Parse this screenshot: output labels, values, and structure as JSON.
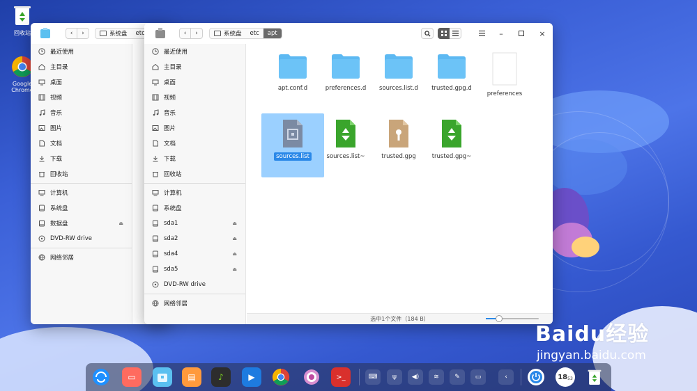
{
  "desktop": {
    "icons": [
      {
        "label": "回收站"
      },
      {
        "label": "Google Chrome",
        "label_line1": "Google",
        "label_line2": "Chrome"
      }
    ]
  },
  "back_window": {
    "breadcrumb": [
      "系统盘",
      "etc"
    ],
    "sidebar": [
      {
        "label": "最近使用",
        "icon": "clock-icon"
      },
      {
        "label": "主目录",
        "icon": "home-icon"
      },
      {
        "label": "桌面",
        "icon": "desktop-icon"
      },
      {
        "label": "视频",
        "icon": "video-icon"
      },
      {
        "label": "音乐",
        "icon": "music-icon"
      },
      {
        "label": "图片",
        "icon": "image-icon"
      },
      {
        "label": "文档",
        "icon": "document-icon"
      },
      {
        "label": "下载",
        "icon": "download-icon"
      },
      {
        "label": "回收站",
        "icon": "trash-icon"
      },
      {
        "label": "计算机",
        "icon": "computer-icon"
      },
      {
        "label": "系统盘",
        "icon": "drive-icon"
      },
      {
        "label": "数据盘",
        "icon": "drive-icon",
        "ejectable": true
      },
      {
        "label": "DVD-RW drive",
        "icon": "disc-icon"
      },
      {
        "label": "网络邻居",
        "icon": "network-icon"
      }
    ]
  },
  "front_window": {
    "breadcrumb": [
      "系统盘",
      "etc",
      "apt"
    ],
    "sidebar": [
      {
        "label": "最近使用",
        "icon": "clock-icon"
      },
      {
        "label": "主目录",
        "icon": "home-icon"
      },
      {
        "label": "桌面",
        "icon": "desktop-icon"
      },
      {
        "label": "视频",
        "icon": "video-icon"
      },
      {
        "label": "音乐",
        "icon": "music-icon"
      },
      {
        "label": "图片",
        "icon": "image-icon"
      },
      {
        "label": "文档",
        "icon": "document-icon"
      },
      {
        "label": "下载",
        "icon": "download-icon"
      },
      {
        "label": "回收站",
        "icon": "trash-icon"
      },
      {
        "label": "计算机",
        "icon": "computer-icon"
      },
      {
        "label": "系统盘",
        "icon": "drive-icon"
      },
      {
        "label": "sda1",
        "icon": "drive-icon",
        "ejectable": true
      },
      {
        "label": "sda2",
        "icon": "drive-icon",
        "ejectable": true
      },
      {
        "label": "sda4",
        "icon": "drive-icon",
        "ejectable": true
      },
      {
        "label": "sda5",
        "icon": "drive-icon",
        "ejectable": true
      },
      {
        "label": "DVD-RW drive",
        "icon": "disc-icon"
      },
      {
        "label": "网络邻居",
        "icon": "network-icon"
      }
    ],
    "files": [
      {
        "name": "apt.conf.d",
        "type": "folder"
      },
      {
        "name": "preferences.d",
        "type": "folder"
      },
      {
        "name": "sources.list.d",
        "type": "folder"
      },
      {
        "name": "trusted.gpg.d",
        "type": "folder"
      },
      {
        "name": "preferences",
        "type": "blank"
      },
      {
        "name": "sources.list",
        "type": "config",
        "selected": true
      },
      {
        "name": "sources.list~",
        "type": "backup"
      },
      {
        "name": "trusted.gpg",
        "type": "key"
      },
      {
        "name": "trusted.gpg~",
        "type": "backup"
      }
    ],
    "status": "选中1个文件（184 B）",
    "zoom_level": 0.25
  },
  "dock": {
    "clock_hour": "18",
    "clock_minute": "53"
  },
  "watermark": {
    "logo": "Baidu经验",
    "url": "jingyan.baidu.com"
  },
  "colors": {
    "selection": "#9bd0ff",
    "accent": "#2a88e8",
    "folder": "#6cc3f7",
    "recycle_green": "#3aa52c"
  }
}
